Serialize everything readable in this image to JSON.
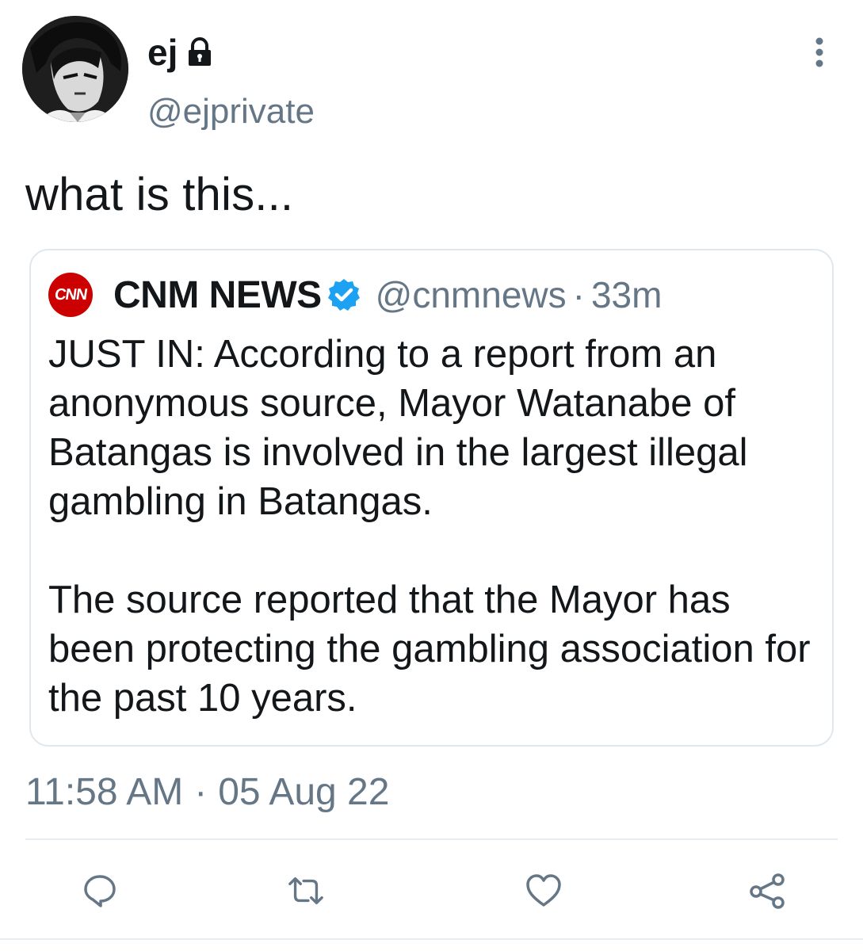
{
  "author": {
    "display_name": "ej",
    "handle": "@ejprivate",
    "protected_icon": "lock-icon",
    "avatar_icon": "anime-character-avatar"
  },
  "tweet": {
    "text": "what is this...",
    "timestamp": "11:58 AM",
    "separator": "·",
    "date": "05 Aug 22"
  },
  "quote": {
    "logo_text": "CNN",
    "name": "CNM NEWS",
    "verified_icon": "verified-badge-icon",
    "handle": "@cnmnews",
    "separator": "·",
    "time_ago": "33m",
    "paragraphs": [
      "JUST IN: According to a report from an anonymous source, Mayor Watanabe of Batangas is involved in the largest illegal gambling in Batangas.",
      "The source reported that the Mayor has been protecting the gambling association for the past 10 years."
    ]
  },
  "actions": [
    {
      "icon": "reply-icon"
    },
    {
      "icon": "retweet-icon"
    },
    {
      "icon": "like-icon"
    },
    {
      "icon": "share-icon"
    }
  ],
  "colors": {
    "text": "#14171a",
    "secondary_text": "#657786",
    "border": "#e1e8ed",
    "verified": "#1da1f2",
    "cnn_red": "#cc0000"
  }
}
